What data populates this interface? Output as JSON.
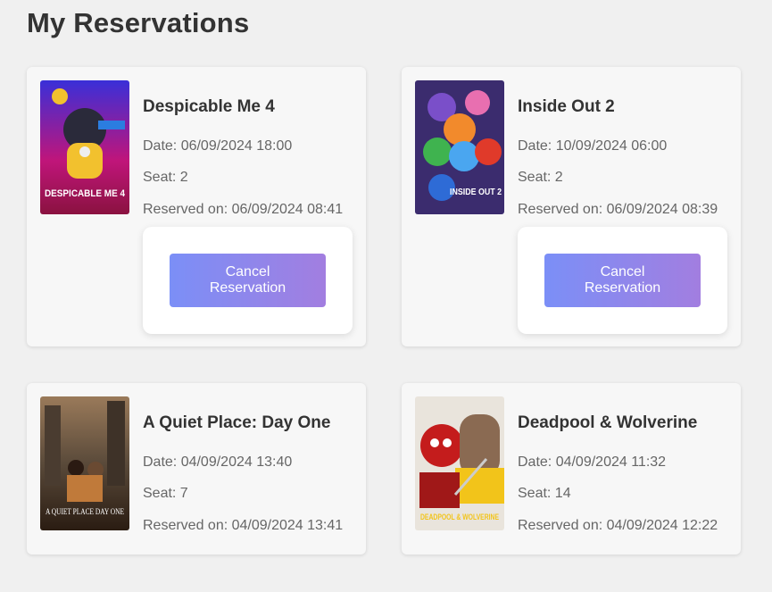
{
  "page": {
    "title": "My Reservations"
  },
  "reservations": [
    {
      "title": "Despicable Me 4",
      "date": "Date: 06/09/2024 18:00",
      "seat": "Seat: 2",
      "reserved_on": "Reserved on: 06/09/2024 08:41",
      "cancel_label": "Cancel Reservation",
      "poster_text": "DESPICABLE ME 4",
      "has_cancel": true
    },
    {
      "title": "Inside Out 2",
      "date": "Date: 10/09/2024 06:00",
      "seat": "Seat: 2",
      "reserved_on": "Reserved on: 06/09/2024 08:39",
      "cancel_label": "Cancel Reservation",
      "poster_text": "INSIDE OUT 2",
      "has_cancel": true
    },
    {
      "title": "A Quiet Place: Day One",
      "date": "Date: 04/09/2024 13:40",
      "seat": "Seat: 7",
      "reserved_on": "Reserved on: 04/09/2024 13:41",
      "poster_text": "A QUIET PLACE DAY ONE",
      "has_cancel": false
    },
    {
      "title": "Deadpool & Wolverine",
      "date": "Date: 04/09/2024 11:32",
      "seat": "Seat: 14",
      "reserved_on": "Reserved on: 04/09/2024 12:22",
      "poster_text": "DEADPOOL & WOLVERINE",
      "has_cancel": false
    }
  ]
}
